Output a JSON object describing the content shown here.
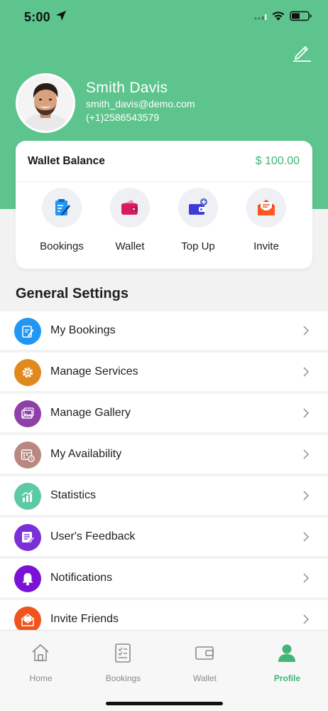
{
  "status_bar": {
    "time": "5:00"
  },
  "profile": {
    "name": "Smith Davis",
    "email": "smith_davis@demo.com",
    "phone": "(+1)2586543579"
  },
  "wallet": {
    "title": "Wallet Balance",
    "amount": "$ 100.00",
    "actions": [
      {
        "label": "Bookings",
        "icon": "bookings-icon"
      },
      {
        "label": "Wallet",
        "icon": "wallet-icon"
      },
      {
        "label": "Top Up",
        "icon": "topup-icon"
      },
      {
        "label": "Invite",
        "icon": "invite-icon"
      }
    ]
  },
  "general_settings": {
    "title": "General Settings",
    "items": [
      {
        "label": "My Bookings",
        "icon": "bookings-icon",
        "color": "#2196f3"
      },
      {
        "label": "Manage Services",
        "icon": "gear-icon",
        "color": "#e08a1e"
      },
      {
        "label": "Manage Gallery",
        "icon": "gallery-icon",
        "color": "#8e3fa8"
      },
      {
        "label": "My Availability",
        "icon": "calendar-icon",
        "color": "#b98880"
      },
      {
        "label": "Statistics",
        "icon": "chart-icon",
        "color": "#5cc9a7"
      },
      {
        "label": "User's Feedback",
        "icon": "feedback-icon",
        "color": "#7b2fd6"
      },
      {
        "label": "Notifications",
        "icon": "bell-icon",
        "color": "#7a12d6"
      },
      {
        "label": "Invite Friends",
        "icon": "invite-icon",
        "color": "#f0541e"
      }
    ]
  },
  "tab_bar": {
    "tabs": [
      {
        "label": "Home",
        "icon": "home-icon"
      },
      {
        "label": "Bookings",
        "icon": "bookings-icon"
      },
      {
        "label": "Wallet",
        "icon": "wallet-icon"
      },
      {
        "label": "Profile",
        "icon": "profile-icon",
        "active": true
      }
    ]
  },
  "colors": {
    "brand": "#5cc48c",
    "accent_text": "#41b676"
  }
}
